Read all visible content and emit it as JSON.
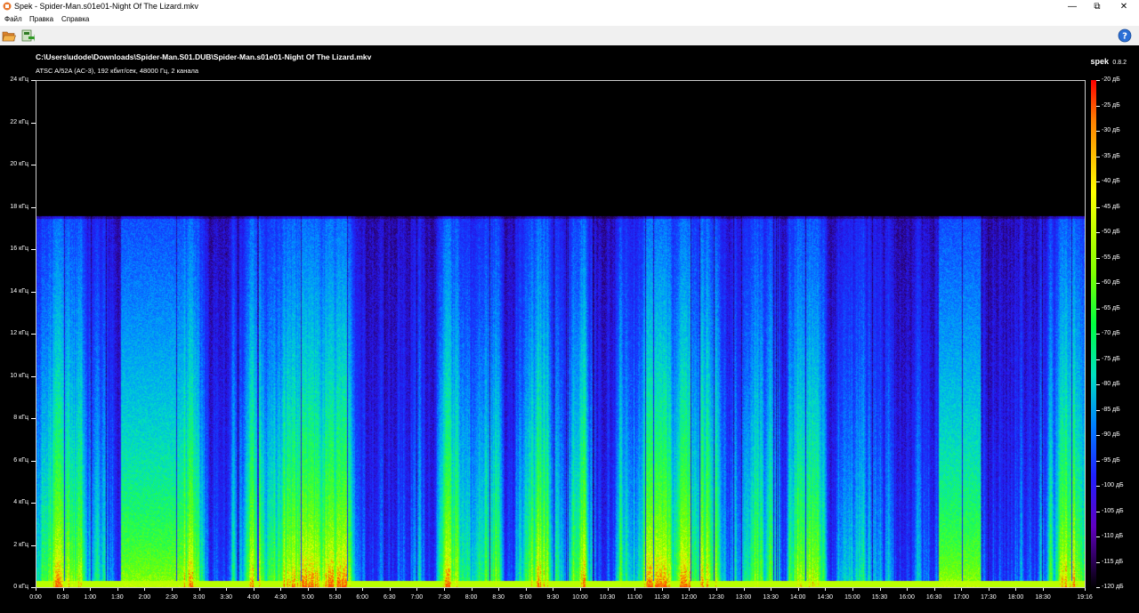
{
  "window": {
    "title": "Spek - Spider-Man.s01e01-Night Of The Lizard.mkv",
    "minimize_icon": "minimize-icon",
    "maximize_icon": "maximize-icon",
    "close_icon": "close-icon"
  },
  "menu": {
    "items": [
      "Файл",
      "Правка",
      "Справка"
    ]
  },
  "toolbar": {
    "open_icon": "folder-open-icon",
    "save_icon": "save-icon",
    "help_icon": "help-icon"
  },
  "file": {
    "path": "C:\\Users\\udode\\Downloads\\Spider-Man.S01.DUB\\Spider-Man.s01e01-Night Of The Lizard.mkv",
    "stream_info": "ATSC A/52A (AC-3), 192 кбит/сек, 48000 Гц, 2 канала"
  },
  "app": {
    "name": "spek",
    "version": "0.8.2"
  },
  "axes": {
    "frequency_labels": [
      "24 кГц",
      "22 кГц",
      "20 кГц",
      "18 кГц",
      "16 кГц",
      "14 кГц",
      "12 кГц",
      "10 кГц",
      "8 кГц",
      "6 кГц",
      "4 кГц",
      "2 кГц",
      "0 кГц"
    ],
    "time_labels": [
      "0:00",
      "0:30",
      "1:00",
      "1:30",
      "2:00",
      "2:30",
      "3:00",
      "3:30",
      "4:00",
      "4:30",
      "5:00",
      "5:30",
      "6:00",
      "6:30",
      "7:00",
      "7:30",
      "8:00",
      "8:30",
      "9:00",
      "9:30",
      "10:00",
      "10:30",
      "11:00",
      "11:30",
      "12:00",
      "12:30",
      "13:00",
      "13:30",
      "14:00",
      "14:30",
      "15:00",
      "15:30",
      "16:00",
      "16:30",
      "17:00",
      "17:30",
      "18:00",
      "18:30",
      "19:16"
    ],
    "db_labels": [
      "-20 дБ",
      "-25 дБ",
      "-30 дБ",
      "-35 дБ",
      "-40 дБ",
      "-45 дБ",
      "-50 дБ",
      "-55 дБ",
      "-60 дБ",
      "-65 дБ",
      "-70 дБ",
      "-75 дБ",
      "-80 дБ",
      "-85 дБ",
      "-90 дБ",
      "-95 дБ",
      "-100 дБ",
      "-105 дБ",
      "-110 дБ",
      "-115 дБ",
      "-120 дБ"
    ]
  },
  "colors": {
    "background": "#000000",
    "scale_top": "#ff0000",
    "scale_bottom": "#000000"
  }
}
